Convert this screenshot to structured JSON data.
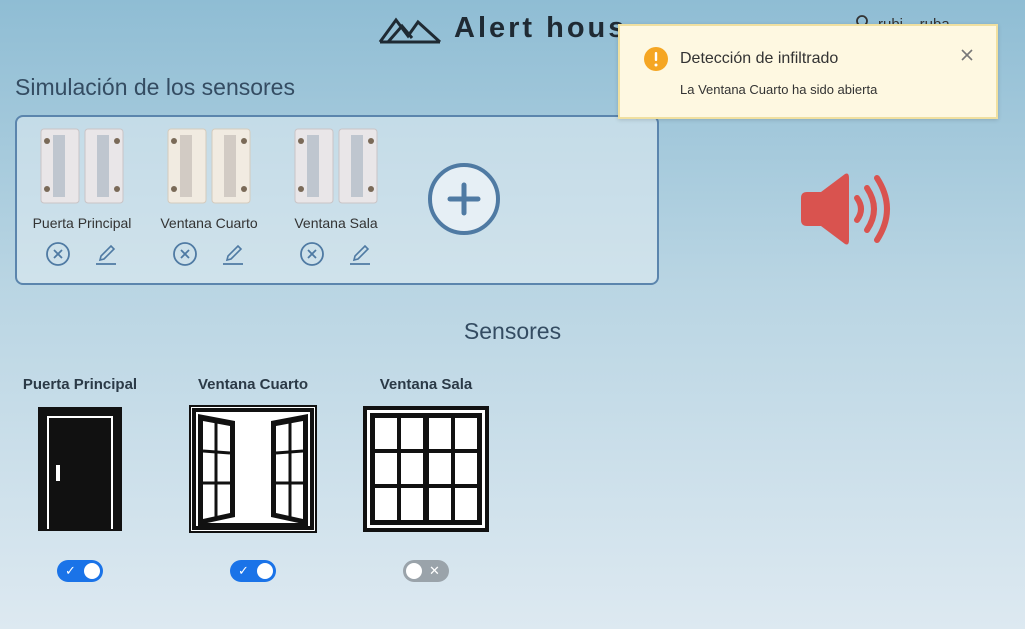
{
  "header": {
    "brand": "Alert hous",
    "user_name": "rubi... ruba"
  },
  "simulation": {
    "title": "Simulación de los sensores",
    "items": [
      {
        "label": "Puerta Principal"
      },
      {
        "label": "Ventana Cuarto"
      },
      {
        "label": "Ventana Sala"
      }
    ]
  },
  "notification": {
    "title": "Detección de infiltrado",
    "message": "La Ventana Cuarto ha sido abierta"
  },
  "sensors": {
    "title": "Sensores",
    "cards": [
      {
        "label": "Puerta Principal",
        "type": "door",
        "enabled": true,
        "glyph": "✓"
      },
      {
        "label": "Ventana Cuarto",
        "type": "window-open",
        "enabled": true,
        "glyph": "✓"
      },
      {
        "label": "Ventana Sala",
        "type": "window-closed",
        "enabled": false,
        "glyph": "✕"
      }
    ]
  },
  "colors": {
    "accent": "#1a73e8",
    "alarm": "#d9534f",
    "warning": "#f5a623",
    "panel_border": "#5b85ad"
  },
  "icons": [
    "logo-icon",
    "user-icon",
    "remove-icon",
    "edit-icon",
    "add-icon",
    "speaker-alarm-icon",
    "warning-icon",
    "close-icon",
    "door-icon",
    "window-open-icon",
    "window-closed-icon"
  ]
}
